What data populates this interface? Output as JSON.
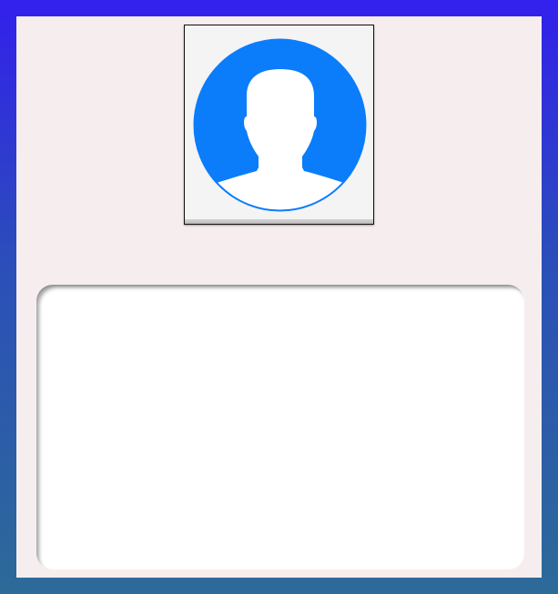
{
  "avatar": {
    "icon": "user-silhouette-icon",
    "circle_color": "#0b7dfa",
    "figure_color": "#ffffff"
  },
  "text_area": {
    "value": "",
    "placeholder": ""
  },
  "colors": {
    "background_top": "#3320ec",
    "background_bottom": "#2d6a98",
    "panel": "#f6eeee"
  }
}
